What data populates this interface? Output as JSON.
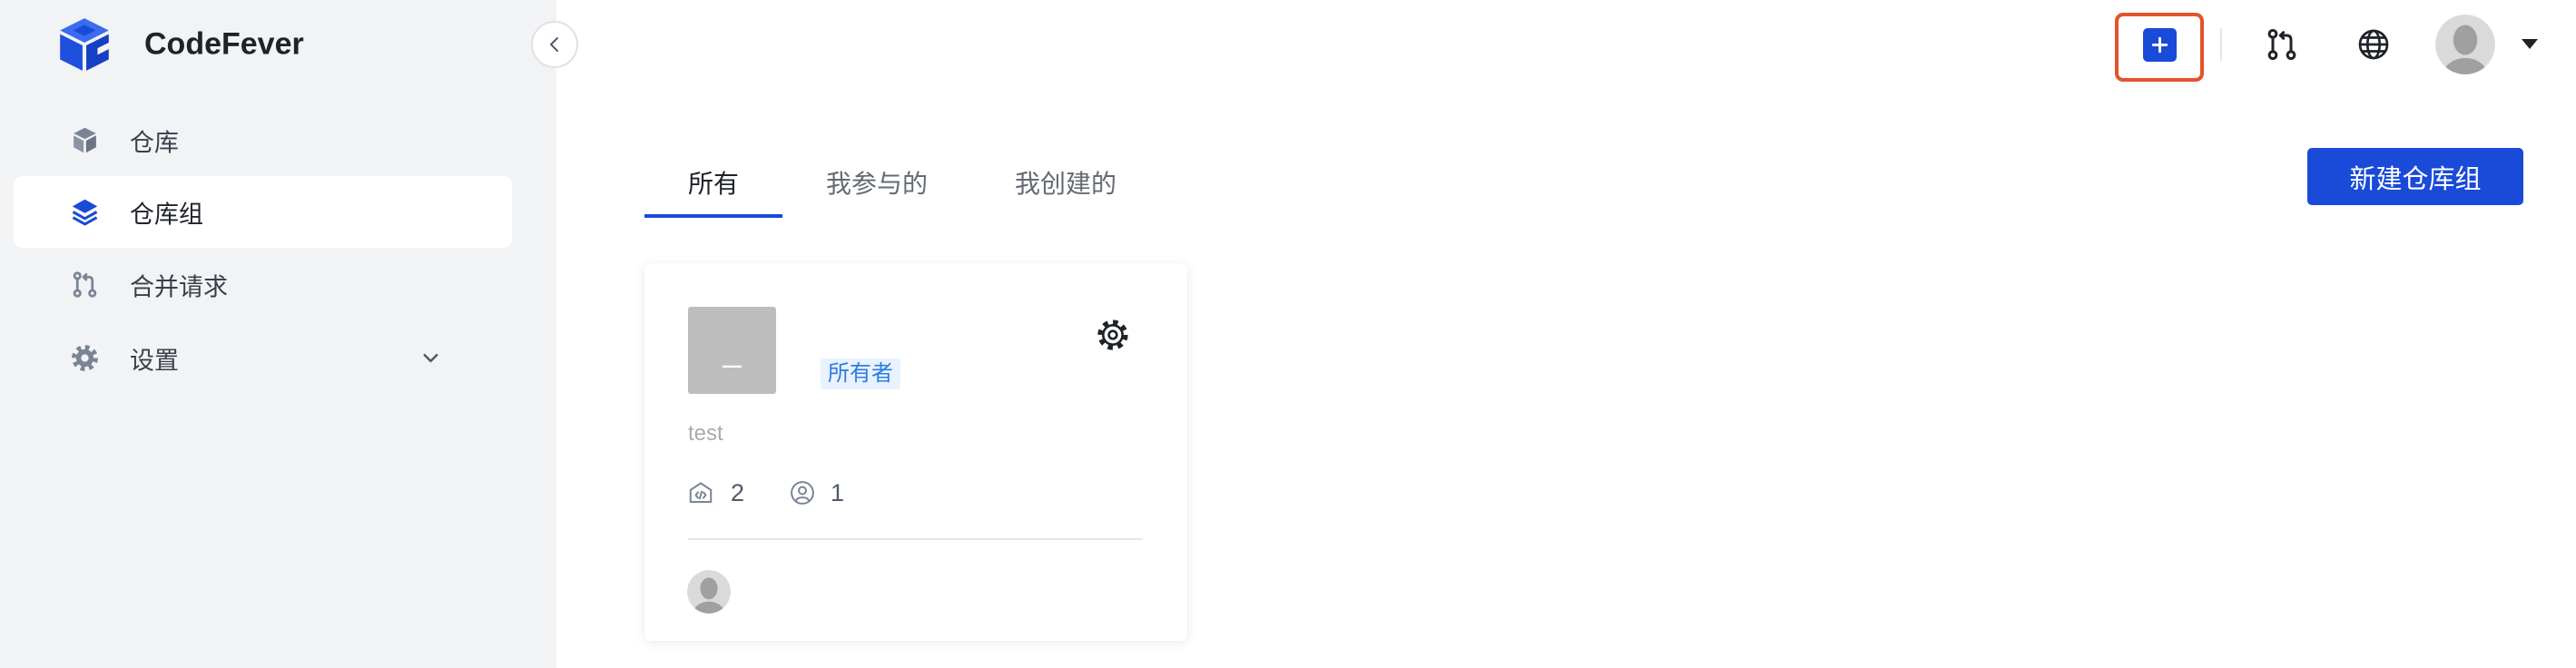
{
  "app": {
    "name": "CodeFever",
    "logo_icon": "codefever-logo-icon"
  },
  "sidebar": {
    "collapse_icon": "chevron-left-icon",
    "items": [
      {
        "label": "仓库",
        "icon": "cube-icon",
        "active": false
      },
      {
        "label": "仓库组",
        "icon": "layers-icon",
        "active": true
      },
      {
        "label": "合并请求",
        "icon": "pull-request-icon",
        "active": false
      },
      {
        "label": "设置",
        "icon": "gear-icon",
        "active": false,
        "expand_icon": "chevron-down-icon"
      }
    ]
  },
  "header": {
    "actions": [
      {
        "icon": "plus-icon",
        "highlighted": true
      },
      {
        "icon": "pull-request-icon"
      },
      {
        "icon": "globe-icon"
      },
      {
        "icon": "avatar-icon",
        "dropdown_icon": "caret-down-icon"
      }
    ]
  },
  "tabs": [
    {
      "label": "所有",
      "active": true
    },
    {
      "label": "我参与的",
      "active": false
    },
    {
      "label": "我创建的",
      "active": false
    }
  ],
  "toolbar": {
    "new_group_label": "新建仓库组"
  },
  "groups": [
    {
      "avatar_text": "_",
      "role": "所有者",
      "description": "test",
      "repo_count": 2,
      "member_count": 1,
      "settings_icon": "gear-icon",
      "repo_icon": "repo-code-icon",
      "member_icon": "user-icon",
      "owner_avatar_icon": "avatar-icon"
    }
  ],
  "colors": {
    "primary": "#1a4ad8",
    "highlight": "#e4532c",
    "sidebar_bg": "#f2f3f5",
    "badge_bg": "#e8f3ff",
    "badge_text": "#2f7be0"
  }
}
